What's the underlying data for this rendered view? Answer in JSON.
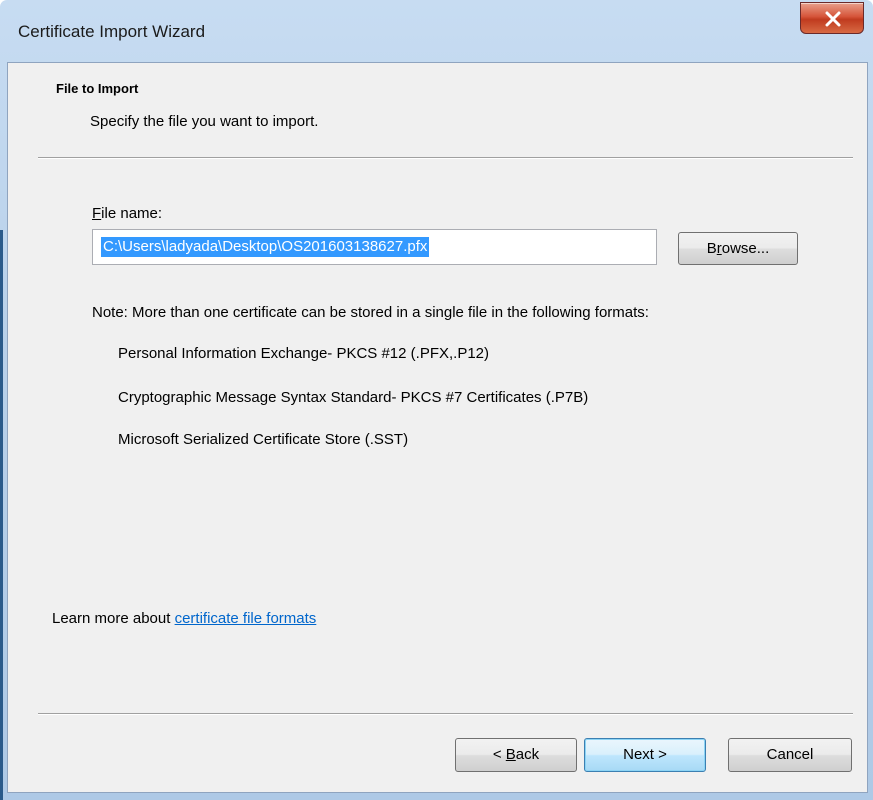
{
  "window": {
    "title": "Certificate Import Wizard",
    "close_symbol": "x"
  },
  "header": {
    "title": "File to Import",
    "subtitle": "Specify the file you want to import."
  },
  "file": {
    "label_mnemonic": "F",
    "label_rest": "ile name:",
    "value": "C:\\Users\\ladyada\\Desktop\\OS201603138627.pfx",
    "browse_mnemonic": "r",
    "browse_pre": "B",
    "browse_post": "owse..."
  },
  "note": {
    "text": "Note:  More than one certificate can be stored in a single file in the following formats:",
    "formats": [
      "Personal Information Exchange- PKCS #12 (.PFX,.P12)",
      "Cryptographic Message Syntax Standard- PKCS #7 Certificates (.P7B)",
      "Microsoft Serialized Certificate Store (.SST)"
    ]
  },
  "learn_more": {
    "prefix": "Learn more about ",
    "link": "certificate file formats"
  },
  "buttons": {
    "back_pre": "< ",
    "back_mnemonic": "B",
    "back_post": "ack",
    "next": "Next >",
    "cancel": "Cancel"
  }
}
